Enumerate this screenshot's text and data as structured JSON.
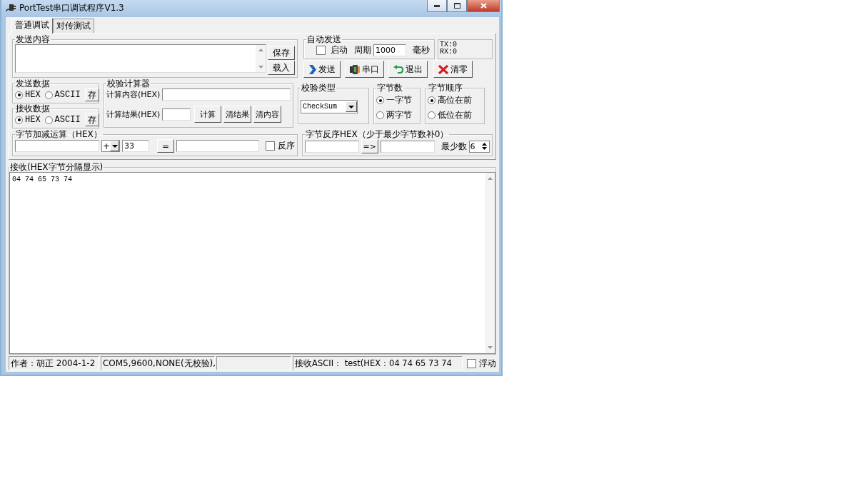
{
  "window": {
    "title": "PortTest串口调试程序V1.3"
  },
  "tabs": [
    {
      "label": "普通调试",
      "selected": true
    },
    {
      "label": "对传测试",
      "selected": false
    }
  ],
  "send_content": {
    "label": "发送内容",
    "buttons": [
      "保存",
      "载入"
    ]
  },
  "auto_send": {
    "label": "自动发送",
    "enable": {
      "label": "启动",
      "checked": false
    },
    "period_label": "周期",
    "period": "1000",
    "unit": "毫秒"
  },
  "counters": [
    "TX:0",
    "RX:0"
  ],
  "action_buttons": [
    {
      "label": "发送",
      "kind": "send"
    },
    {
      "label": "串口",
      "kind": "port"
    },
    {
      "label": "退出",
      "kind": "exit"
    },
    {
      "label": "清零",
      "kind": "clear"
    }
  ],
  "send_data": {
    "label": "发送数据",
    "options": [
      {
        "label": "HEX",
        "selected": true
      },
      {
        "label": "ASCII",
        "selected": false
      }
    ],
    "button": "存"
  },
  "receive_data": {
    "label": "接收数据",
    "options": [
      {
        "label": "HEX",
        "selected": true
      },
      {
        "label": "ASCII",
        "selected": false
      }
    ],
    "button": "存"
  },
  "checksum_calc": {
    "label": "校验计算器",
    "content_label": "计算内容(HEX)",
    "result_label": "计算结果(HEX)",
    "buttons": [
      "计算",
      "清结果",
      "清内容"
    ]
  },
  "checksum_type": {
    "label": "校验类型",
    "value": "CheckSum"
  },
  "byte_count": {
    "label": "字节数",
    "options": [
      {
        "label": "一字节",
        "selected": true
      },
      {
        "label": "两字节",
        "selected": false
      }
    ]
  },
  "byte_order": {
    "label": "字节顺序",
    "options": [
      {
        "label": "高位在前",
        "selected": true
      },
      {
        "label": "低位在前",
        "selected": false
      }
    ]
  },
  "byte_arith": {
    "label": "字节加减运算（HEX）",
    "operator": "+",
    "operand": "33",
    "equals": "=",
    "reverse": {
      "label": "反序",
      "checked": false
    }
  },
  "byte_reverse": {
    "label": "字节反序HEX（少于最少字节数补0）",
    "arrow": "=>",
    "min_label": "最少数",
    "min_value": "6"
  },
  "receive": {
    "label": "接收(HEX字节分隔显示)",
    "text": "04 74 65 73 74"
  },
  "status_bar": {
    "author": "作者：胡正  2004-1-2",
    "port": "COM5,9600,NONE(无校验),",
    "received": "接收ASCII： test(HEX：04 74 65 73 74",
    "float": {
      "label": "浮动",
      "checked": false
    }
  }
}
